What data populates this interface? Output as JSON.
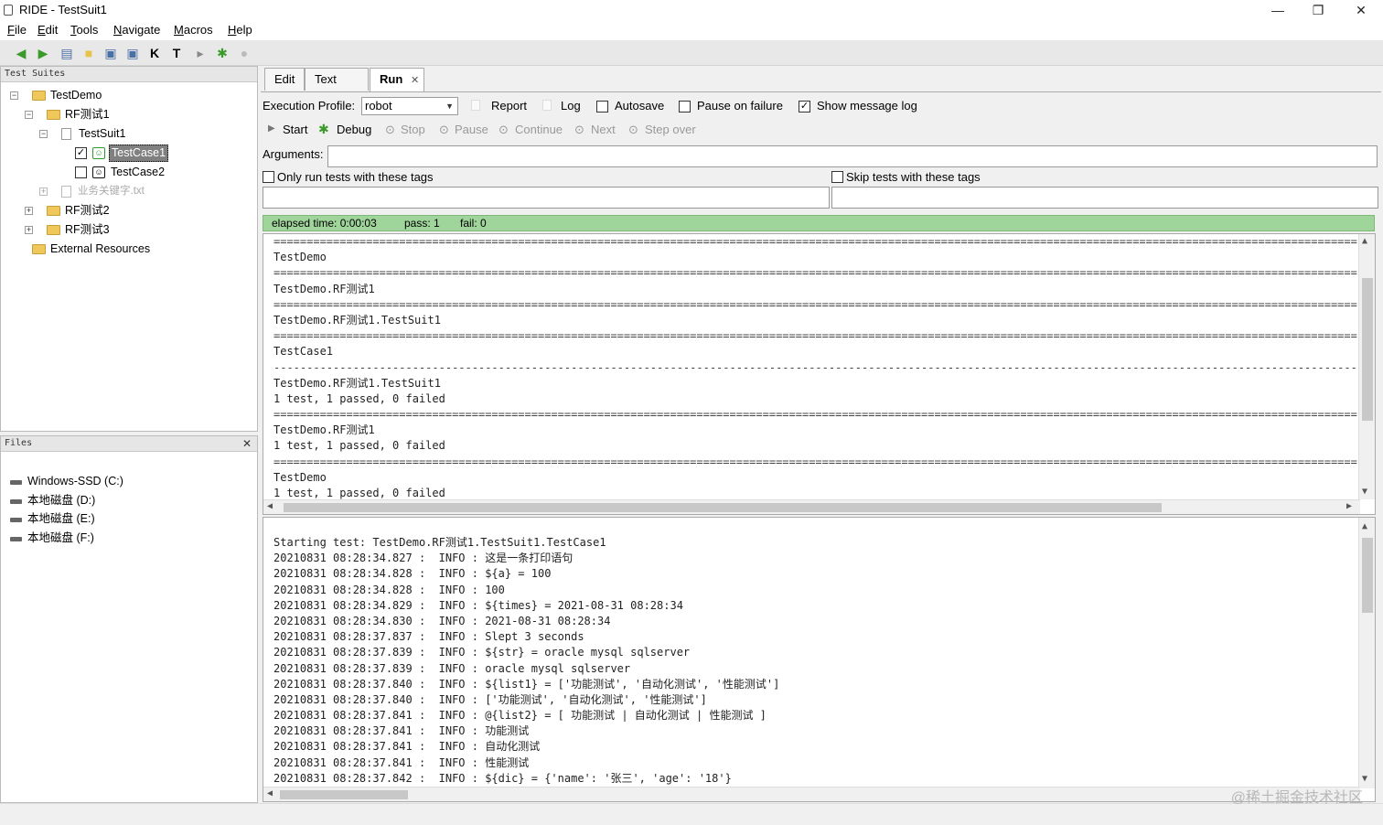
{
  "window": {
    "title": "RIDE - TestSuit1",
    "controls": [
      "—",
      "❐",
      "✕"
    ]
  },
  "menu": [
    {
      "label": "File",
      "u": "F"
    },
    {
      "label": "Edit",
      "u": "E"
    },
    {
      "label": "Tools",
      "u": "T"
    },
    {
      "label": "Navigate",
      "u": "N"
    },
    {
      "label": "Macros",
      "u": "M"
    },
    {
      "label": "Help",
      "u": "H"
    }
  ],
  "toolbar_icons": [
    "back-icon",
    "forward-icon",
    "open-icon",
    "new-folder-icon",
    "save-icon",
    "save-all-icon",
    "search-keywords-icon",
    "search-tests-icon",
    "run-icon",
    "debug-icon",
    "stop-icon"
  ],
  "tree": {
    "header": "Test Suites",
    "nodes": [
      {
        "label": "TestDemo",
        "level": 0,
        "type": "folder",
        "expander": "−"
      },
      {
        "label": "RF测试1",
        "level": 1,
        "type": "folder",
        "expander": "−"
      },
      {
        "label": "TestSuit1",
        "level": 2,
        "type": "doc",
        "expander": "−"
      },
      {
        "label": "TestCase1",
        "level": 3,
        "type": "testcase",
        "checked": true,
        "selected": true
      },
      {
        "label": "TestCase2",
        "level": 3,
        "type": "testcase",
        "checked": false
      },
      {
        "label": "业务关键字.txt",
        "level": 2,
        "type": "resource",
        "expander": "+",
        "muted": true
      },
      {
        "label": "RF测试2",
        "level": 1,
        "type": "folder",
        "expander": "+"
      },
      {
        "label": "RF测试3",
        "level": 1,
        "type": "folder",
        "expander": "+"
      },
      {
        "label": "External Resources",
        "level": 1,
        "type": "folder"
      }
    ]
  },
  "files": {
    "header": "Files",
    "close": "✕",
    "drives": [
      "Windows-SSD (C:)",
      "本地磁盘 (D:)",
      "本地磁盘 (E:)",
      "本地磁盘 (F:)"
    ]
  },
  "tabs": [
    {
      "label": "Edit"
    },
    {
      "label": "Text Edit"
    },
    {
      "label": "Run",
      "active": true,
      "close": "✕"
    }
  ],
  "run": {
    "profile_label": "Execution Profile:",
    "profile_value": "robot",
    "report_label": "Report",
    "log_label": "Log",
    "autosave_label": "Autosave",
    "pause_label": "Pause on failure",
    "show_log_label": "Show message log",
    "autosave": false,
    "pause_on_failure": false,
    "show_message_log": true,
    "buttons": {
      "start": "Start",
      "debug": "Debug",
      "stop": "Stop",
      "pause": "Pause",
      "continue": "Continue",
      "next": "Next",
      "step_over": "Step over"
    },
    "arguments_label": "Arguments:",
    "only_tags_label": "Only run tests with these tags",
    "skip_tags_label": "Skip tests with these tags",
    "status": {
      "elapsed": "elapsed time: 0:00:03",
      "pass": "pass: 1",
      "fail": "fail: 0",
      "color": "#9fd49a"
    }
  },
  "console_output": [
    {
      "t": "eq"
    },
    {
      "t": "text",
      "v": "TestDemo"
    },
    {
      "t": "eq"
    },
    {
      "t": "text",
      "v": "TestDemo.RF测试1"
    },
    {
      "t": "eq"
    },
    {
      "t": "text",
      "v": "TestDemo.RF测试1.TestSuit1"
    },
    {
      "t": "eq"
    },
    {
      "t": "text",
      "v": "TestCase1"
    },
    {
      "t": "dash"
    },
    {
      "t": "text",
      "v": "TestDemo.RF测试1.TestSuit1"
    },
    {
      "t": "text",
      "v": "1 test, 1 passed, 0 failed"
    },
    {
      "t": "eq"
    },
    {
      "t": "text",
      "v": "TestDemo.RF测试1"
    },
    {
      "t": "text",
      "v": "1 test, 1 passed, 0 failed"
    },
    {
      "t": "eq"
    },
    {
      "t": "text",
      "v": "TestDemo"
    },
    {
      "t": "text",
      "v": "1 test, 1 passed, 0 failed"
    }
  ],
  "message_log": [
    "Starting test: TestDemo.RF测试1.TestSuit1.TestCase1",
    "20210831 08:28:34.827 :  INFO : 这是一条打印语句",
    "20210831 08:28:34.828 :  INFO : ${a} = 100",
    "20210831 08:28:34.828 :  INFO : 100",
    "20210831 08:28:34.829 :  INFO : ${times} = 2021-08-31 08:28:34",
    "20210831 08:28:34.830 :  INFO : 2021-08-31 08:28:34",
    "20210831 08:28:37.837 :  INFO : Slept 3 seconds",
    "20210831 08:28:37.839 :  INFO : ${str} = oracle mysql sqlserver",
    "20210831 08:28:37.839 :  INFO : oracle mysql sqlserver",
    "20210831 08:28:37.840 :  INFO : ${list1} = ['功能测试', '自动化测试', '性能测试']",
    "20210831 08:28:37.840 :  INFO : ['功能测试', '自动化测试', '性能测试']",
    "20210831 08:28:37.841 :  INFO : @{list2} = [ 功能测试 | 自动化测试 | 性能测试 ]",
    "20210831 08:28:37.841 :  INFO : 功能测试",
    "20210831 08:28:37.841 :  INFO : 自动化测试",
    "20210831 08:28:37.841 :  INFO : 性能测试",
    "20210831 08:28:37.842 :  INFO : ${dic} = {'name': '张三', 'age': '18'}"
  ],
  "watermark": "@稀土掘金技术社区"
}
